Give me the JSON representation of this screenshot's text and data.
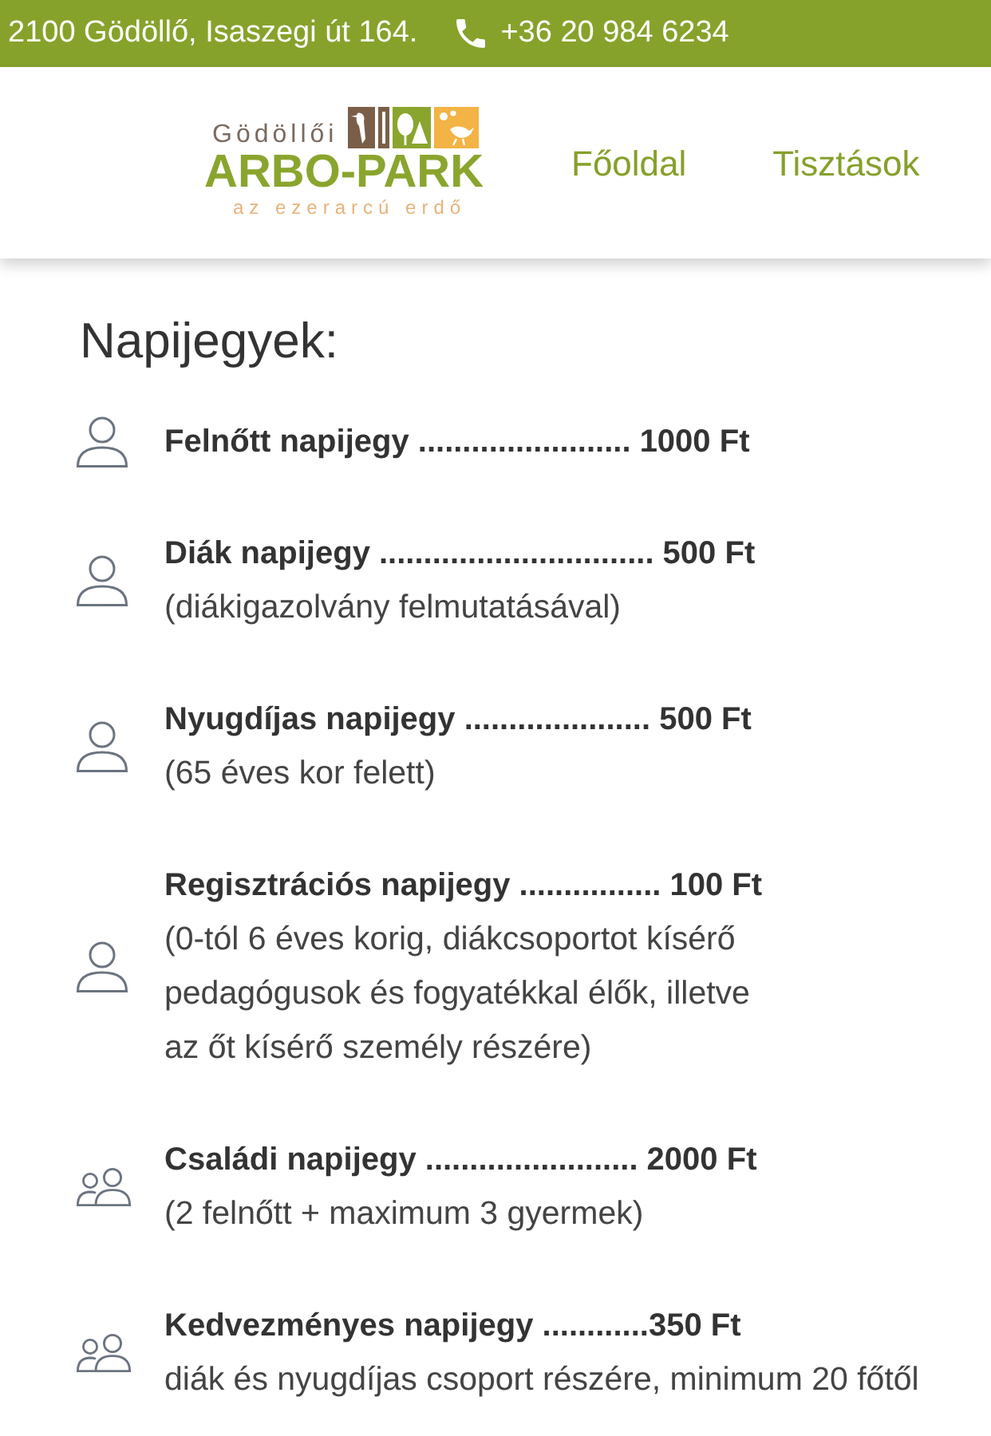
{
  "top_bar": {
    "address": "2100 Gödöllő, Isaszegi út 164.",
    "phone": "+36 20 984 6234"
  },
  "header": {
    "logo": {
      "overline": "Gödöllői",
      "name": "ARBO-PARK",
      "tagline": "az ezerarcú erdő"
    },
    "nav": [
      "Főoldal",
      "Tisztások"
    ]
  },
  "section": {
    "title": "Napijegyek:",
    "tickets": [
      {
        "kind": "person",
        "title": "Felnőtt napijegy ........................ 1000 Ft"
      },
      {
        "kind": "person",
        "title": "Diák napijegy ............................... 500 Ft",
        "note": "(diákigazolvány felmutatásával)"
      },
      {
        "kind": "person",
        "title": "Nyugdíjas napijegy ..................... 500 Ft",
        "note": "(65 éves kor felett)"
      },
      {
        "kind": "person",
        "title": "Regisztrációs napijegy ................ 100 Ft",
        "note": "(0-tól 6 éves korig, diákcsoportot kísérő\npedagógusok és fogyatékkal élők, illetve\naz őt kísérő személy részére)"
      },
      {
        "kind": "group",
        "title": "Családi napijegy ........................ 2000 Ft",
        "note": "(2 felnőtt + maximum 3 gyermek)"
      },
      {
        "kind": "group",
        "title": "Kedvezményes napijegy ............350 Ft",
        "note": "diák és nyugdíjas csoport részére, minimum 20 főtől"
      }
    ]
  }
}
